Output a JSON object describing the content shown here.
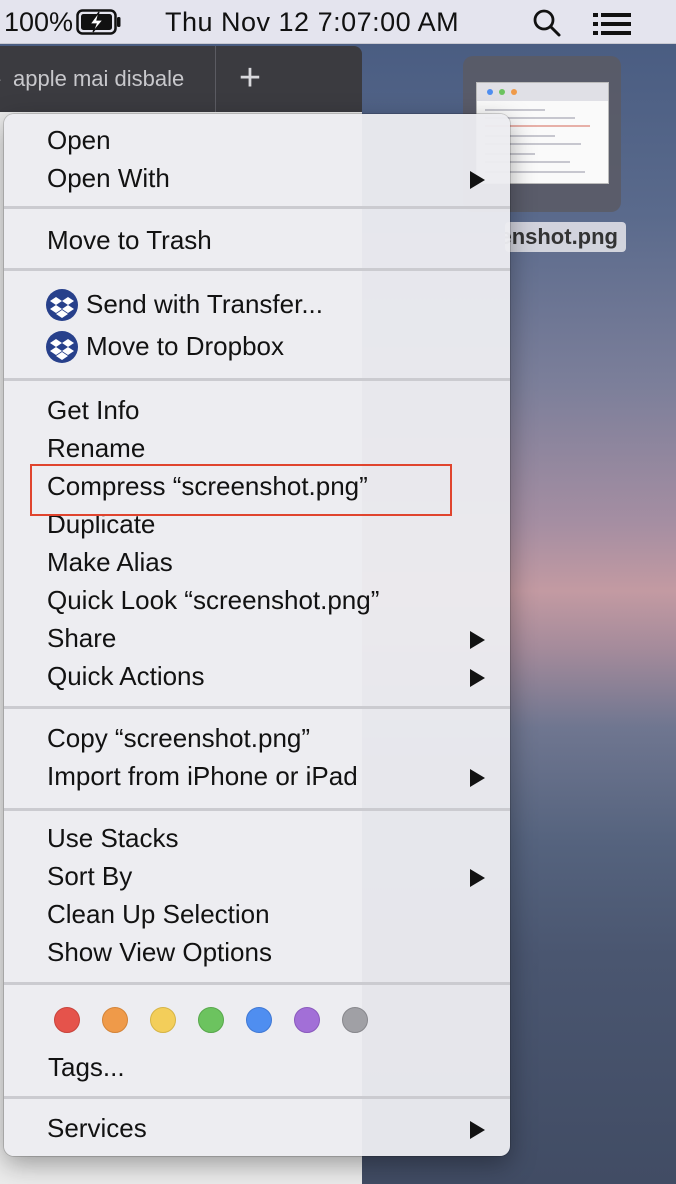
{
  "menubar": {
    "battery_percent": "100%",
    "battery_icon": "battery-charging-icon",
    "clock": "Thu Nov 12  7:07:00 AM",
    "spotlight_icon": "search-icon",
    "control_icon": "list-icon"
  },
  "finder": {
    "tab_label": "apple mai disbale",
    "new_tab": "+"
  },
  "desktop": {
    "file_label": "screenshot.png",
    "file_label_visible": "enshot.png"
  },
  "menu": {
    "open": "Open",
    "open_with": "Open With",
    "move_to_trash": "Move to Trash",
    "send_with_transfer": "Send with Transfer...",
    "move_to_dropbox": "Move to Dropbox",
    "get_info": "Get Info",
    "rename": "Rename",
    "compress": "Compress “screenshot.png”",
    "duplicate": "Duplicate",
    "make_alias": "Make Alias",
    "quick_look": "Quick Look “screenshot.png”",
    "share": "Share",
    "quick_actions": "Quick Actions",
    "copy": "Copy “screenshot.png”",
    "import_from_iphone": "Import from iPhone or iPad",
    "use_stacks": "Use Stacks",
    "sort_by": "Sort By",
    "clean_up_selection": "Clean Up Selection",
    "show_view_options": "Show View Options",
    "tags": "Tags...",
    "services": "Services"
  },
  "tag_colors": {
    "red": "#e5534b",
    "orange": "#ef9a49",
    "yellow": "#f3ce5a",
    "green": "#6cc35f",
    "blue": "#4f8ef0",
    "purple": "#a26fd7",
    "gray": "#a0a0a5"
  },
  "highlight_color": "#e0442e"
}
